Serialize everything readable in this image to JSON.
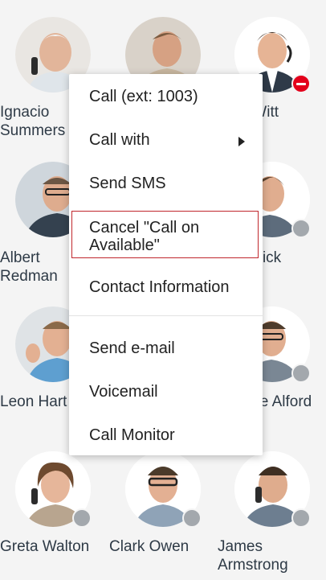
{
  "contacts": [
    {
      "id": "ignacio",
      "name": "Ignacio\nSummers",
      "status": "none"
    },
    {
      "id": "c2",
      "name": "",
      "status": "none"
    },
    {
      "id": "paul",
      "name": "Paul Witt",
      "status": "busy"
    },
    {
      "id": "albert",
      "name": "Albert\nRedman",
      "status": "none"
    },
    {
      "id": "c5",
      "name": "",
      "status": "none"
    },
    {
      "id": "frederick",
      "name": "Frederick\nWelch",
      "status": "offline"
    },
    {
      "id": "leon",
      "name": "Leon Hart",
      "status": "none"
    },
    {
      "id": "c8",
      "name": "",
      "status": "none"
    },
    {
      "id": "george",
      "name": "George Alford",
      "status": "offline"
    },
    {
      "id": "greta",
      "name": "Greta Walton",
      "status": "offline"
    },
    {
      "id": "clark",
      "name": "Clark Owen",
      "status": "offline"
    },
    {
      "id": "james",
      "name": "James\nArmstrong",
      "status": "offline"
    }
  ],
  "menu": {
    "items": [
      {
        "label": "Call (ext: 1003)"
      },
      {
        "label": "Call with"
      },
      {
        "label": "Send SMS"
      },
      {
        "label": "Cancel \"Call on\nAvailable\""
      },
      {
        "label": "Contact Information"
      },
      {
        "label": "Send e-mail"
      },
      {
        "label": "Voicemail"
      },
      {
        "label": "Call Monitor"
      }
    ]
  },
  "colors": {
    "background": "#f4f4f4",
    "busy": "#e3001b",
    "offline": "#a3a8ad",
    "highlight_border": "#c0272d"
  }
}
